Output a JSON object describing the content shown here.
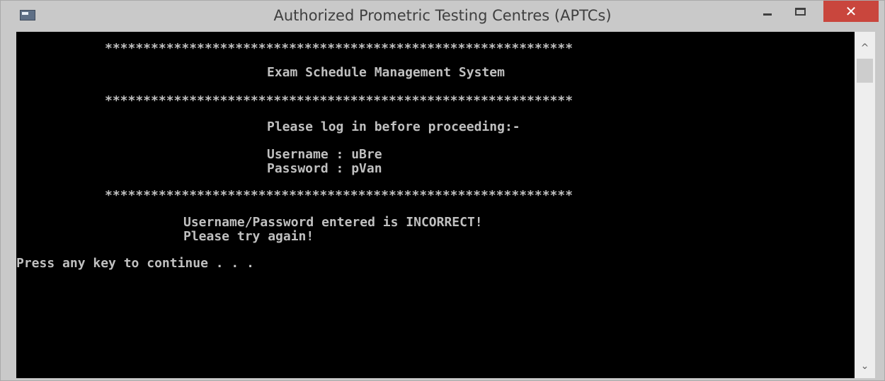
{
  "window": {
    "title": "Authorized Prometric Testing Centres (APTCs)",
    "icons": {
      "app": "console-app-icon",
      "minimize": "minimize-icon",
      "maximize": "maximize-icon",
      "close": "close-icon"
    },
    "close_glyph": "✕",
    "close_color": "#c9463d"
  },
  "console": {
    "background": "#000000",
    "text_color": "#c0c0c0",
    "separator": "*************************************************************",
    "system_title": "Exam Schedule Management System",
    "login_prompt": "Please log in before proceeding:-",
    "username_line": "Username : uBre",
    "password_line": "Password : pVan",
    "error_line_1": "Username/Password entered is INCORRECT!",
    "error_line_2": "Please try again!",
    "continue_prompt": "Press any key to continue . . ."
  },
  "scrollbar": {
    "up_glyph": "^",
    "down_glyph": "⌄"
  }
}
